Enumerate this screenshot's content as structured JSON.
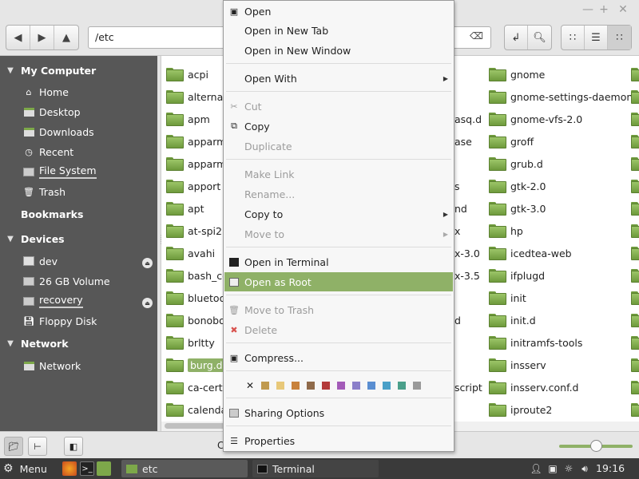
{
  "window": {
    "minimize": "—",
    "maximize": "+",
    "close": "✕"
  },
  "toolbar": {
    "location_value": "/etc",
    "back_icon": "back-arrow-icon",
    "forward_icon": "forward-arrow-icon",
    "up_icon": "up-arrow-icon"
  },
  "sidebar": {
    "my_computer": "My Computer",
    "computer_items": [
      {
        "label": "Home",
        "icon": "home-icon"
      },
      {
        "label": "Desktop",
        "icon": "desktop-icon"
      },
      {
        "label": "Downloads",
        "icon": "downloads-icon"
      },
      {
        "label": "Recent",
        "icon": "recent-icon"
      },
      {
        "label": "File System",
        "icon": "drive-icon"
      },
      {
        "label": "Trash",
        "icon": "trash-icon"
      }
    ],
    "bookmarks": "Bookmarks",
    "devices": "Devices",
    "device_items": [
      {
        "label": "dev"
      },
      {
        "label": "26 GB Volume"
      },
      {
        "label": "recovery"
      },
      {
        "label": "Floppy Disk"
      }
    ],
    "network": "Network",
    "network_items": [
      {
        "label": "Network"
      }
    ]
  },
  "files": {
    "col1": [
      "acpi",
      "alternat",
      "apm",
      "apparm",
      "apparm",
      "apport",
      "apt",
      "at-spi2",
      "avahi",
      "bash_co",
      "bluetoo",
      "bonobo-",
      "brltty",
      "burg.d",
      "ca-certif",
      "calenda"
    ],
    "col2_partial": [
      "asq.d",
      "ase",
      "s",
      "nd",
      "x",
      "x-3.0",
      "x-3.5",
      "d",
      "script"
    ],
    "col3": [
      "gnome",
      "gnome-settings-daemon",
      "gnome-vfs-2.0",
      "groff",
      "grub.d",
      "gtk-2.0",
      "gtk-3.0",
      "hp",
      "icedtea-web",
      "ifplugd",
      "init",
      "init.d",
      "initramfs-tools",
      "insserv",
      "insserv.conf.d",
      "iproute2"
    ],
    "selected": "burg.d"
  },
  "context_menu": {
    "open": "Open",
    "open_new_tab": "Open in New Tab",
    "open_new_window": "Open in New Window",
    "open_with": "Open With",
    "cut": "Cut",
    "copy": "Copy",
    "duplicate": "Duplicate",
    "make_link": "Make Link",
    "rename": "Rename...",
    "copy_to": "Copy to",
    "move_to": "Move to",
    "open_in_terminal": "Open in Terminal",
    "open_as_root": "Open as Root",
    "move_to_trash": "Move to Trash",
    "delete": "Delete",
    "compress": "Compress...",
    "sharing_options": "Sharing Options",
    "properties": "Properties",
    "color_clear": "✕",
    "colors": [
      "#c09a4f",
      "#e8c879",
      "#c8823c",
      "#8f6a4a",
      "#b33a3a",
      "#a35bb8",
      "#8a7fc9",
      "#5a8ed1",
      "#4aa0c8",
      "#4a9f8a",
      "#9a9a9a"
    ]
  },
  "statusbar": {
    "text_left": "C",
    "text_right": "p",
    "zoom_level": 0.5
  },
  "taskbar": {
    "menu_label": "Menu",
    "tasks": [
      {
        "label": "etc",
        "active": true
      },
      {
        "label": "Terminal",
        "active": false
      }
    ],
    "clock": "19:16"
  },
  "colors": {
    "accent": "#8fb167",
    "sidebar_bg": "#575757",
    "folder_green": "#7da84a"
  }
}
